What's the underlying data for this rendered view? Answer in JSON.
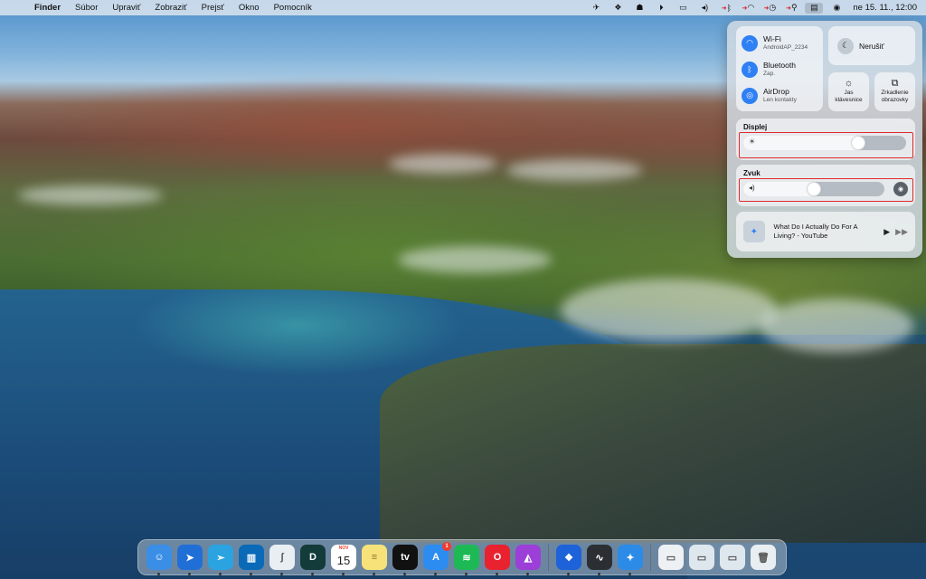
{
  "menubar": {
    "apple_icon": "apple-logo",
    "app_name": "Finder",
    "menus": [
      "Súbor",
      "Upraviť",
      "Zobraziť",
      "Prejsť",
      "Okno",
      "Pomocník"
    ],
    "status_icons": [
      "telegram-icon",
      "dropbox-icon",
      "alfred-icon",
      "play-icon",
      "battery-icon",
      "volume-icon",
      "bluetooth-icon",
      "wifi-icon",
      "time-machine-icon",
      "search-icon",
      "control-center-icon",
      "siri-icon"
    ],
    "clock": "ne 15. 11.,  12:00"
  },
  "control_center": {
    "wifi": {
      "title": "Wi-Fi",
      "subtitle": "AndroidAP_2234"
    },
    "bluetooth": {
      "title": "Bluetooth",
      "subtitle": "Zap."
    },
    "airdrop": {
      "title": "AirDrop",
      "subtitle": "Len kontakty"
    },
    "dnd": {
      "label": "Nerušiť"
    },
    "keyboard_brightness": {
      "label_line1": "Jas",
      "label_line2": "klávesnice"
    },
    "screen_mirroring": {
      "label_line1": "Zrkadlenie",
      "label_line2": "obrazovky"
    },
    "display": {
      "label": "Displej",
      "level": 0.75
    },
    "sound": {
      "label": "Zvuk",
      "level": 0.55
    },
    "now_playing": {
      "title": "What Do I Actually Do For A Living? - YouTube"
    },
    "accent_color": "#2f7ff5",
    "highlight_color": "#e02a2a"
  },
  "dock": {
    "apps": [
      {
        "name": "finder",
        "icon": "finder-icon",
        "glyph": "☺",
        "color": "#3a8ee6"
      },
      {
        "name": "spark",
        "icon": "spark-icon",
        "glyph": "➤",
        "color": "#1f6fd6"
      },
      {
        "name": "telegram",
        "icon": "telegram-icon",
        "glyph": "➢",
        "color": "#2aa3e0"
      },
      {
        "name": "trello",
        "icon": "trello-icon",
        "glyph": "▥",
        "color": "#0a6ab8"
      },
      {
        "name": "scrivener",
        "icon": "scrivener-icon",
        "glyph": "ʃ",
        "color": "#e8eef2"
      },
      {
        "name": "dashlane",
        "icon": "dashlane-icon",
        "glyph": "D",
        "color": "#123b3a"
      },
      {
        "name": "calendar",
        "icon": "calendar-icon",
        "month": "NOV",
        "day": "15",
        "color": "#ffffff"
      },
      {
        "name": "notes",
        "icon": "notes-icon",
        "glyph": "≡",
        "color": "#f7e27a"
      },
      {
        "name": "apple-tv",
        "icon": "apple-tv-icon",
        "glyph": "tv",
        "color": "#111111"
      },
      {
        "name": "app-store",
        "icon": "app-store-icon",
        "glyph": "A",
        "color": "#2d8cf0",
        "badge": "1"
      },
      {
        "name": "spotify",
        "icon": "spotify-icon",
        "glyph": "≋",
        "color": "#1db954"
      },
      {
        "name": "opera",
        "icon": "opera-icon",
        "glyph": "O",
        "color": "#e8222f"
      },
      {
        "name": "affinity-photo",
        "icon": "affinity-photo-icon",
        "glyph": "◭",
        "color": "#9b3fd8"
      },
      {
        "name": "dropbox",
        "icon": "dropbox-icon",
        "glyph": "❖",
        "color": "#1d62d8"
      },
      {
        "name": "activity-monitor",
        "icon": "activity-monitor-icon",
        "glyph": "∿",
        "color": "#2b2f33"
      },
      {
        "name": "safari",
        "icon": "safari-icon",
        "glyph": "✦",
        "color": "#2b8be6"
      }
    ],
    "docs": [
      {
        "name": "document-pdf",
        "icon": "document-icon",
        "color": "#eef1f4"
      },
      {
        "name": "downloads-stack",
        "icon": "folder-stack-icon",
        "color": "#dfe7ee"
      },
      {
        "name": "documents-stack",
        "icon": "folder-stack-icon",
        "color": "#dfe7ee"
      },
      {
        "name": "trash",
        "icon": "trash-icon",
        "color": "#e9eef2"
      }
    ]
  }
}
